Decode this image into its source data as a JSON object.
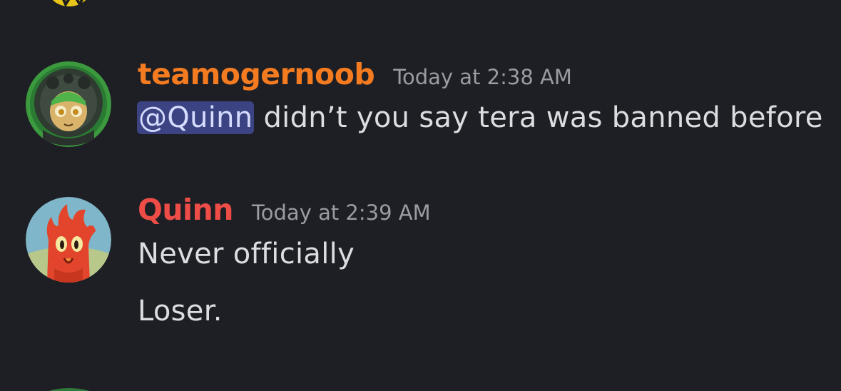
{
  "messages": [
    {
      "author": "teamogernoob",
      "author_color": "#f47b20",
      "timestamp": "Today at 2:38 AM",
      "mention": "@Quinn",
      "text": " didn’t you say tera was banned before",
      "avatar_icon": "green-hooded-character-avatar"
    },
    {
      "author": "Quinn",
      "author_color": "#ee4d47",
      "timestamp": "Today at 2:39 AM",
      "lines": [
        "Never officially",
        "Loser."
      ],
      "avatar_icon": "orange-fire-creature-avatar"
    }
  ],
  "colors": {
    "background": "#1e1f24",
    "mention_bg": "#3c4382",
    "text": "#dcdde1",
    "timestamp": "#9a9ba3"
  }
}
